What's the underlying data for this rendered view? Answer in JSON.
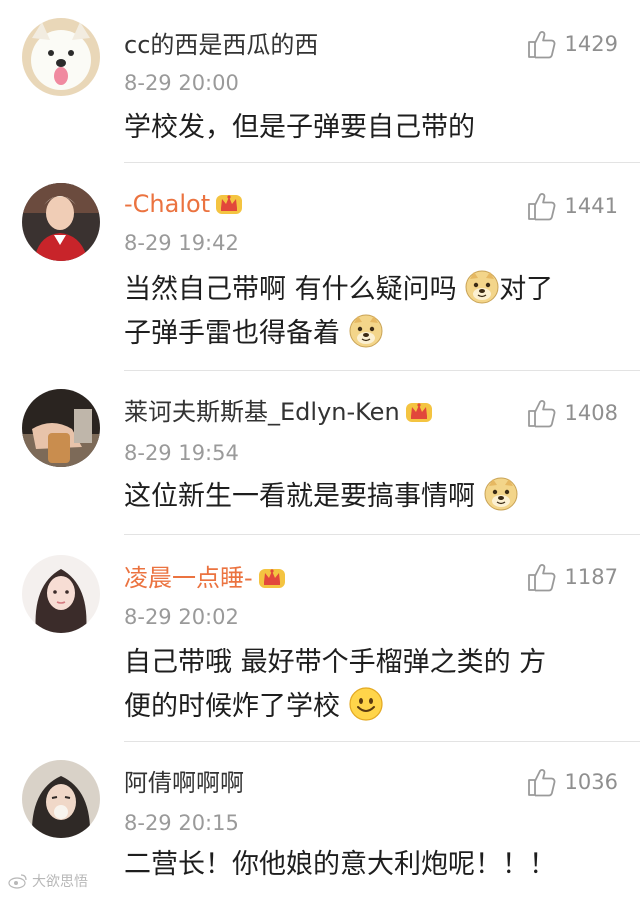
{
  "comments": [
    {
      "username": "cc的西是西瓜的西",
      "time": "8-29 20:00",
      "likes": "1429",
      "text": "学校发，但是子弹要自己带的"
    },
    {
      "username": "-Chalot",
      "time": "8-29 19:42",
      "likes": "1441",
      "text_line1": "当然自己带啊 有什么疑问吗",
      "text_line1b": "对了",
      "text_line2": "子弹手雷也得备着"
    },
    {
      "username": "莱诃夫斯斯基_Edlyn-Ken",
      "time": "8-29 19:54",
      "likes": "1408",
      "text": "这位新生一看就是要搞事情啊"
    },
    {
      "username": "凌晨一点睡-",
      "time": "8-29 20:02",
      "likes": "1187",
      "text_line1": "自己带哦 最好带个手榴弹之类的 方",
      "text_line2": "便的时候炸了学校"
    },
    {
      "username": "阿倩啊啊啊",
      "time": "8-29 20:15",
      "likes": "1036",
      "text": "二营长！你他娘的意大利炮呢！！！"
    }
  ],
  "watermark": "大欲思悟",
  "colors": {
    "vip_name": "#eb7340",
    "normal_name": "#333333",
    "timestamp": "#9a9a9a",
    "like": "#8f8f8f",
    "divider": "#e3e3e3"
  },
  "icons": {
    "like": "thumbs-up-icon",
    "vip": "crown-icon",
    "doge": "doge-emoji",
    "smile": "smile-emoji"
  }
}
